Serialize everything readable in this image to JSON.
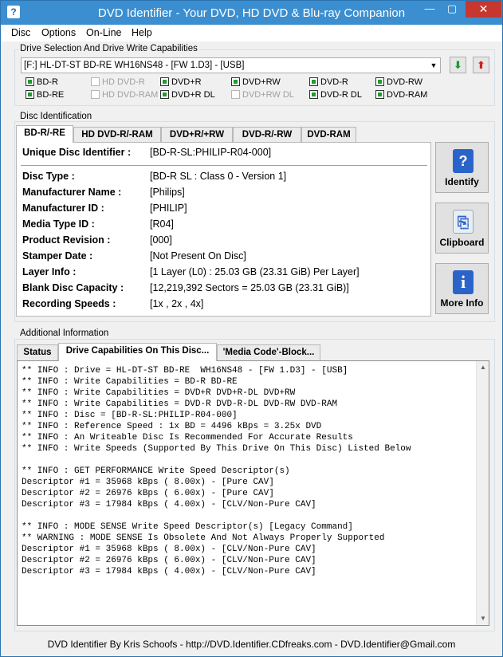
{
  "window": {
    "title": "DVD Identifier - Your DVD, HD DVD & Blu-ray Companion",
    "app_icon": "?",
    "minimize_glyph": "—",
    "maximize_glyph": "▢",
    "close_glyph": "✕"
  },
  "menu": [
    "Disc",
    "Options",
    "On-Line",
    "Help"
  ],
  "drive": {
    "group_label": "Drive Selection And Drive Write Capabilities",
    "selected": "[F:] HL-DT-ST BD-RE  WH16NS48 - [FW 1.D3] - [USB]",
    "down_arrow": "⬇",
    "up_arrow": "⬆",
    "capabilities": [
      {
        "label": "BD-R",
        "checked": true,
        "enabled": true
      },
      {
        "label": "HD DVD-R",
        "checked": false,
        "enabled": false
      },
      {
        "label": "DVD+R",
        "checked": true,
        "enabled": true
      },
      {
        "label": "DVD+RW",
        "checked": true,
        "enabled": true
      },
      {
        "label": "DVD-R",
        "checked": true,
        "enabled": true
      },
      {
        "label": "DVD-RW",
        "checked": true,
        "enabled": true
      },
      {
        "label": "BD-RE",
        "checked": true,
        "enabled": true
      },
      {
        "label": "HD DVD-RAM",
        "checked": false,
        "enabled": false
      },
      {
        "label": "DVD+R DL",
        "checked": true,
        "enabled": true
      },
      {
        "label": "DVD+RW DL",
        "checked": false,
        "enabled": false
      },
      {
        "label": "DVD-R DL",
        "checked": true,
        "enabled": true
      },
      {
        "label": "DVD-RAM",
        "checked": true,
        "enabled": true
      }
    ]
  },
  "disc": {
    "group_label": "Disc Identification",
    "tabs": [
      "BD-R/-RE",
      "HD DVD-R/-RAM",
      "DVD+R/+RW",
      "DVD-R/-RW",
      "DVD-RAM"
    ],
    "unique_label": "Unique Disc Identifier :",
    "unique_value": "[BD-R-SL:PHILIP-R04-000]",
    "fields": [
      {
        "label": "Disc Type :",
        "value": "[BD-R SL : Class 0 - Version 1]"
      },
      {
        "label": "Manufacturer Name :",
        "value": "[Philips]"
      },
      {
        "label": "Manufacturer ID :",
        "value": "[PHILIP]"
      },
      {
        "label": "Media Type ID :",
        "value": "[R04]"
      },
      {
        "label": "Product Revision :",
        "value": "[000]"
      },
      {
        "label": "Stamper Date :",
        "value": "[Not Present On Disc]"
      },
      {
        "label": "Layer Info :",
        "value": "[1 Layer (L0) : 25.03 GB (23.31 GiB) Per Layer]"
      },
      {
        "label": "Blank Disc Capacity :",
        "value": "[12,219,392 Sectors = 25.03 GB (23.31 GiB)]"
      },
      {
        "label": "Recording Speeds :",
        "value": "[1x , 2x , 4x]"
      }
    ],
    "buttons": [
      {
        "label": "Identify",
        "icon": "?"
      },
      {
        "label": "Clipboard",
        "icon": "⎘"
      },
      {
        "label": "More Info",
        "icon": "i"
      }
    ]
  },
  "additional": {
    "group_label": "Additional Information",
    "tabs": [
      "Status",
      "Drive Capabilities On This Disc...",
      "'Media Code'-Block..."
    ],
    "log_lines": [
      "** INFO : Drive = HL-DT-ST BD-RE  WH16NS48 - [FW 1.D3] - [USB]",
      "** INFO : Write Capabilities = BD-R BD-RE",
      "** INFO : Write Capabilities = DVD+R DVD+R-DL DVD+RW",
      "** INFO : Write Capabilities = DVD-R DVD-R-DL DVD-RW DVD-RAM",
      "** INFO : Disc = [BD-R-SL:PHILIP-R04-000]",
      "** INFO : Reference Speed : 1x BD = 4496 kBps = 3.25x DVD",
      "** INFO : An Writeable Disc Is Recommended For Accurate Results",
      "** INFO : Write Speeds (Supported By This Drive On This Disc) Listed Below",
      "",
      "** INFO : GET PERFORMANCE Write Speed Descriptor(s)",
      "Descriptor #1 = 35968 kBps ( 8.00x) - [Pure CAV]",
      "Descriptor #2 = 26976 kBps ( 6.00x) - [Pure CAV]",
      "Descriptor #3 = 17984 kBps ( 4.00x) - [CLV/Non-Pure CAV]",
      "",
      "** INFO : MODE SENSE Write Speed Descriptor(s) [Legacy Command]",
      "** WARNING : MODE SENSE Is Obsolete And Not Always Properly Supported",
      "Descriptor #1 = 35968 kBps ( 8.00x) - [CLV/Non-Pure CAV]",
      "Descriptor #2 = 26976 kBps ( 6.00x) - [CLV/Non-Pure CAV]",
      "Descriptor #3 = 17984 kBps ( 4.00x) - [CLV/Non-Pure CAV]"
    ]
  },
  "status_bar": "DVD Identifier By Kris Schoofs  -  http://DVD.Identifier.CDfreaks.com  -  DVD.Identifier@Gmail.com",
  "colors": {
    "accent": "#3b8ed0",
    "close": "#c7372f",
    "check": "#1e9a2f",
    "icon_blue": "#2b64c9"
  }
}
